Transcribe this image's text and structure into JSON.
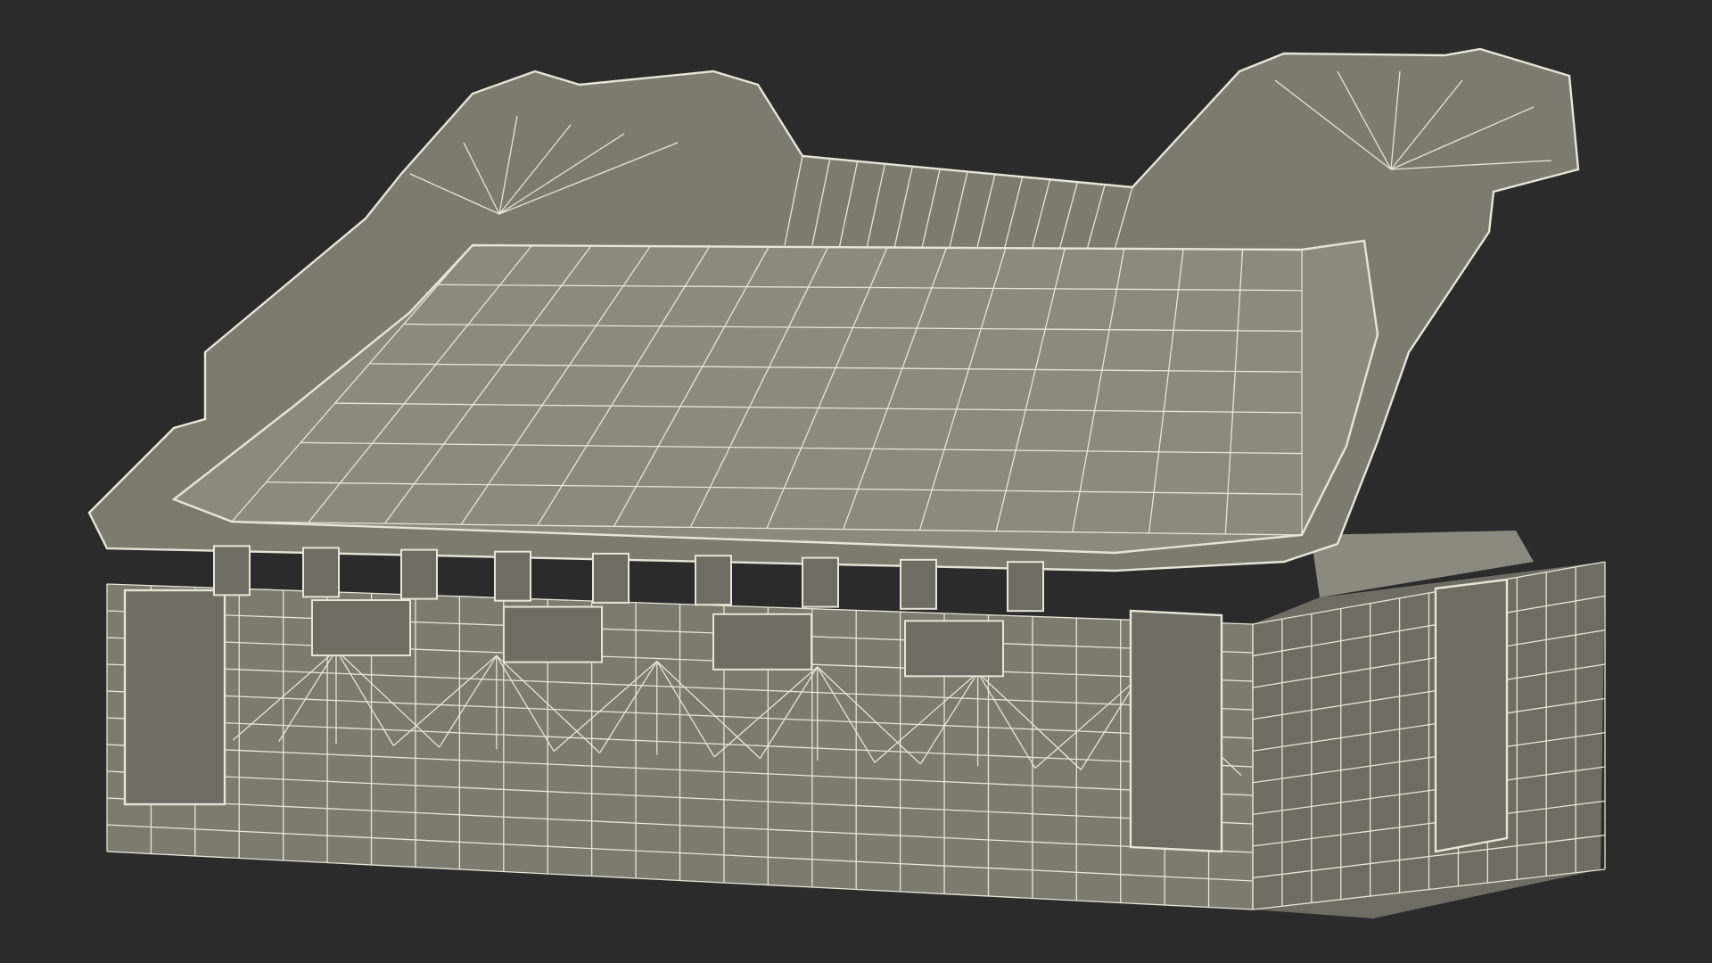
{
  "scene": {
    "subject": "case",
    "render_style": "wireframe",
    "colors": {
      "background": "#2b2b2b",
      "surface_fill": "#7b7b70",
      "surface_fill_dark": "#6d6d63",
      "surface_fill_light": "#8a8a7e",
      "wire": "#e6e6d6"
    }
  }
}
